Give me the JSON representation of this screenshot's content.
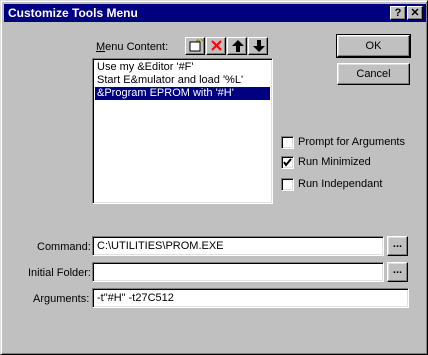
{
  "window": {
    "title": "Customize Tools Menu",
    "help_button": "?",
    "close_button": "✕"
  },
  "menu_content": {
    "label_prefix": "M",
    "label_rest": "enu Content:",
    "items": [
      {
        "label": "Use my &Editor '#F'",
        "selected": false
      },
      {
        "label": "Start E&mulator and load '%L'",
        "selected": false
      },
      {
        "label": "&Program EPROM with '#H'",
        "selected": true
      }
    ],
    "toolbar": [
      "new-item-icon",
      "delete-icon",
      "move-up-icon",
      "move-down-icon"
    ]
  },
  "buttons": {
    "ok": "OK",
    "cancel": "Cancel",
    "browse_command": "...",
    "browse_folder": "..."
  },
  "options": {
    "prompt_for_arguments": {
      "label": "Prompt for  Arguments",
      "checked": false
    },
    "run_minimized": {
      "label": "Run Minimized",
      "checked": true
    },
    "run_independant": {
      "label": "Run Independant",
      "checked": false
    }
  },
  "fields": {
    "command": {
      "label": "Command:",
      "value": "C:\\UTILITIES\\PROM.EXE"
    },
    "initial_folder": {
      "label": "Initial Folder:",
      "value": ""
    },
    "arguments": {
      "label": "Arguments:",
      "value": "-t\"#H\" -t27C512"
    }
  },
  "colors": {
    "face": "#c0c0c0",
    "title_bar": "#000080",
    "selection": "#000080",
    "delete_red": "#ff0000"
  }
}
